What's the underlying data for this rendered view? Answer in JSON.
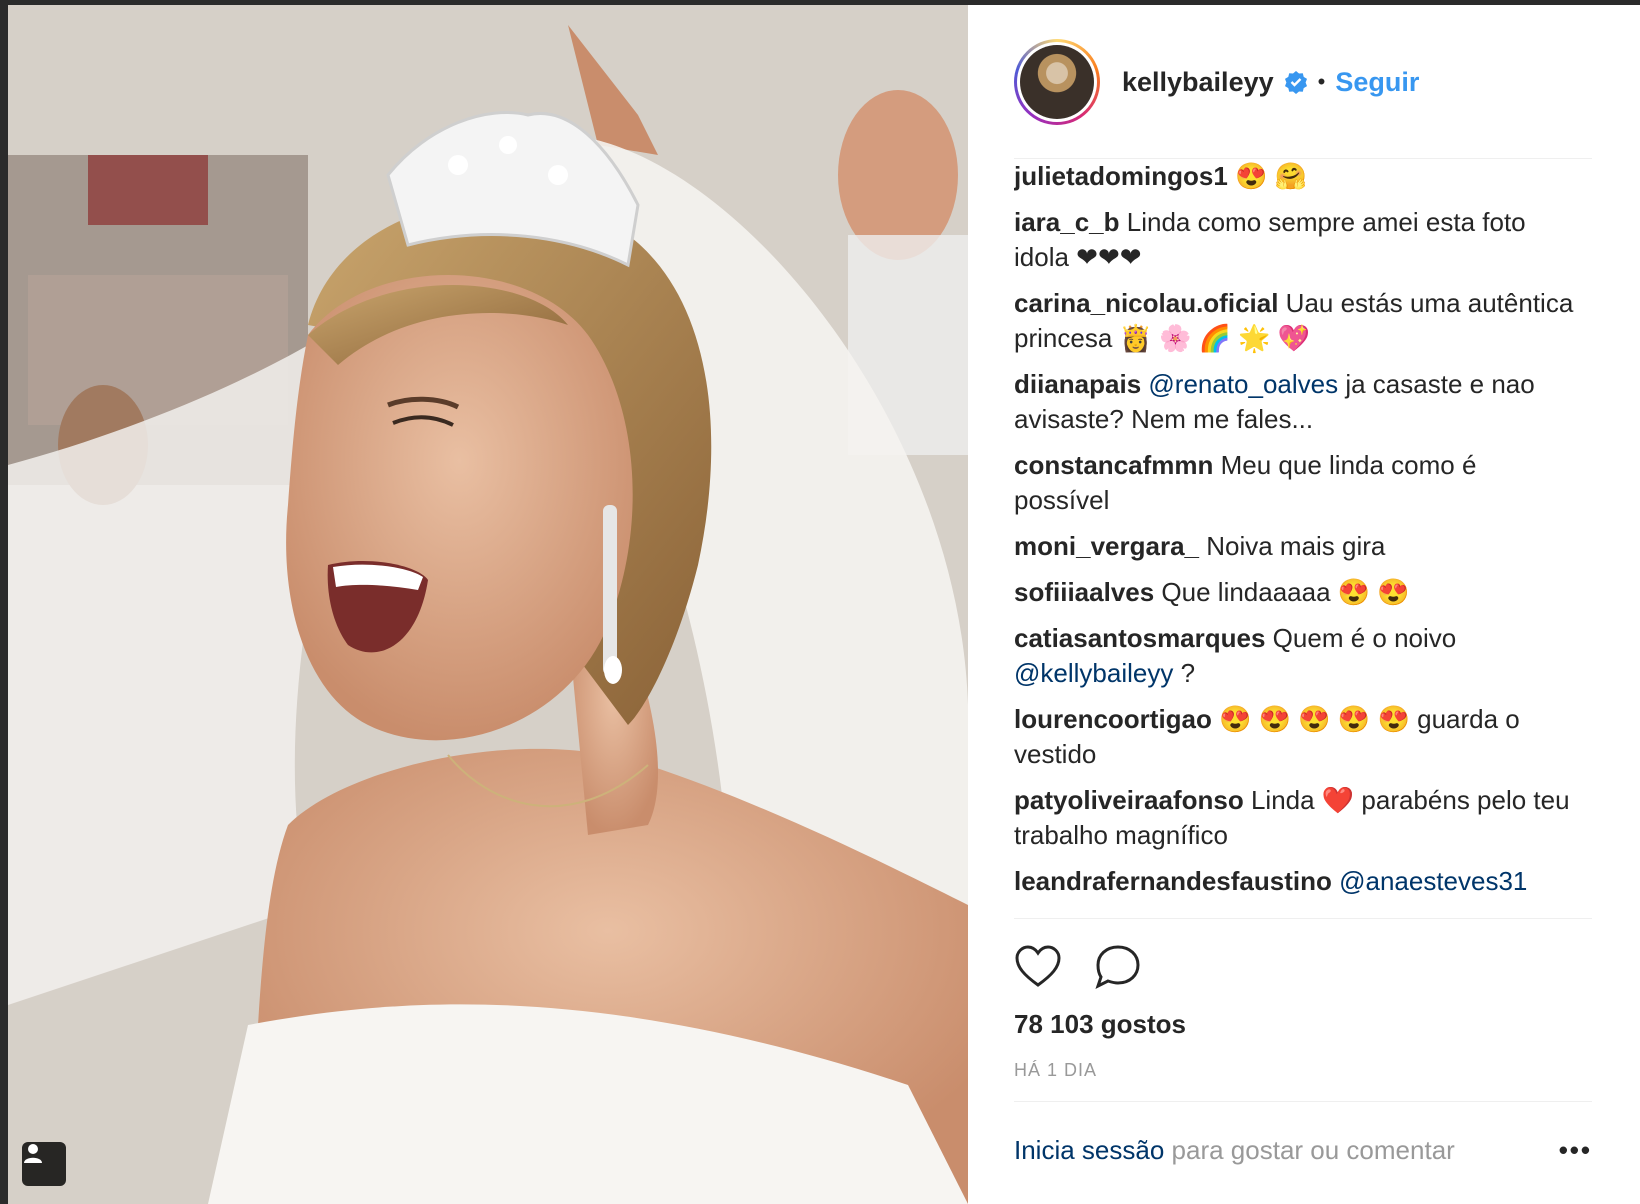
{
  "post": {
    "username": "kellybaileyy",
    "follow_label": "Seguir",
    "separator": "•",
    "comments": [
      {
        "user": "julietadomingos1",
        "parts": [
          {
            "t": " 😍 🤗"
          }
        ]
      },
      {
        "user": "iara_c_b",
        "parts": [
          {
            "t": " Linda como sempre amei esta foto idola ❤❤❤"
          }
        ]
      },
      {
        "user": "carina_nicolau.oficial",
        "parts": [
          {
            "t": " Uau estás uma autêntica princesa 👸 🌸 🌈 🌟 💖"
          }
        ]
      },
      {
        "user": "diianapais",
        "parts": [
          {
            "t": " "
          },
          {
            "m": "@renato_oalves"
          },
          {
            "t": " ja casaste e nao avisaste? Nem me fales..."
          }
        ]
      },
      {
        "user": "constancafmmn",
        "parts": [
          {
            "t": " Meu que linda como é possível"
          }
        ]
      },
      {
        "user": "moni_vergara_",
        "parts": [
          {
            "t": " Noiva mais gira"
          }
        ]
      },
      {
        "user": "sofiiiaalves",
        "parts": [
          {
            "t": " Que lindaaaaa 😍 😍"
          }
        ]
      },
      {
        "user": "catiasantosmarques",
        "parts": [
          {
            "t": " Quem é o noivo "
          },
          {
            "m": "@kellybaileyy"
          },
          {
            "t": " ?"
          }
        ]
      },
      {
        "user": "lourencoortigao",
        "parts": [
          {
            "t": " 😍 😍 😍 😍 😍  guarda o vestido"
          }
        ]
      },
      {
        "user": "patyoliveiraafonso",
        "parts": [
          {
            "t": " Linda ❤️  parabéns pelo teu trabalho magnífico"
          }
        ]
      },
      {
        "user": "leandrafernandesfaustino",
        "parts": [
          {
            "t": " "
          },
          {
            "m": "@anaesteves31"
          }
        ]
      }
    ],
    "likes": "78 103 gostos",
    "time": "HÁ 1 DIA",
    "login_link": "Inicia sessão",
    "login_rest": " para gostar ou comentar",
    "more_label": "•••"
  },
  "icons": [
    "tag-user-icon",
    "verified-badge-icon",
    "heart-icon",
    "comment-icon",
    "more-options-icon"
  ],
  "colors": {
    "link_blue": "#3897f0",
    "mention_blue": "#003569",
    "text": "#262626",
    "muted": "#999999"
  }
}
